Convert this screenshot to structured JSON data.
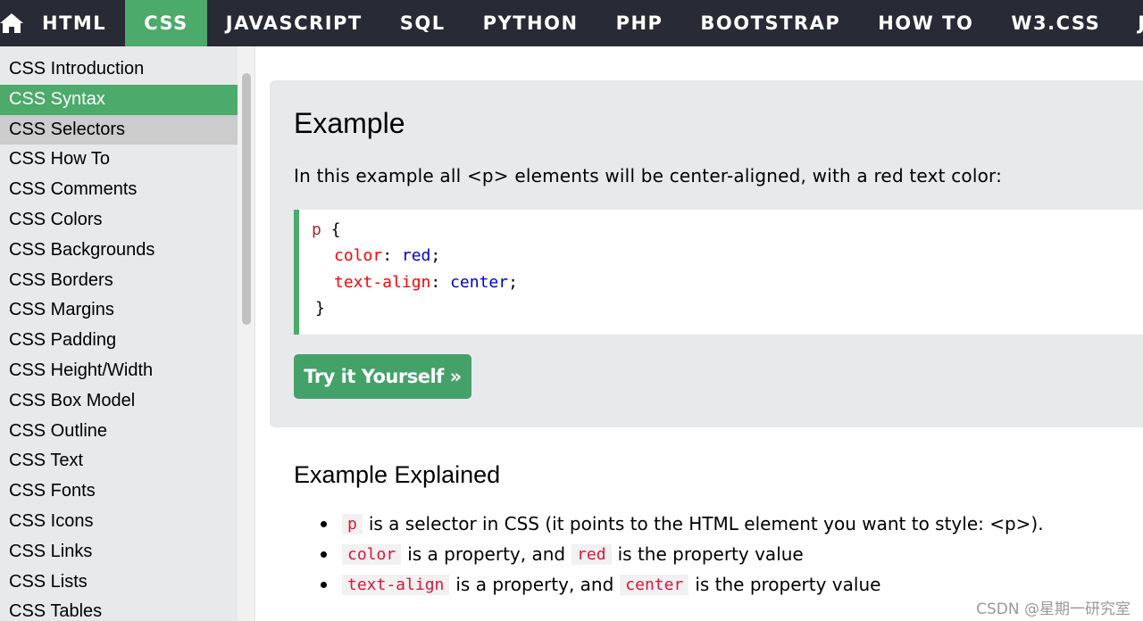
{
  "nav": {
    "home_icon": "home-icon",
    "items": [
      "HTML",
      "CSS",
      "JAVASCRIPT",
      "SQL",
      "PYTHON",
      "PHP",
      "BOOTSTRAP",
      "HOW TO",
      "W3.CSS",
      "JAVA",
      "J"
    ],
    "active": "CSS"
  },
  "sidebar": {
    "items": [
      "CSS Introduction",
      "CSS Syntax",
      "CSS Selectors",
      "CSS How To",
      "CSS Comments",
      "CSS Colors",
      "CSS Backgrounds",
      "CSS Borders",
      "CSS Margins",
      "CSS Padding",
      "CSS Height/Width",
      "CSS Box Model",
      "CSS Outline",
      "CSS Text",
      "CSS Fonts",
      "CSS Icons",
      "CSS Links",
      "CSS Lists",
      "CSS Tables"
    ],
    "active": "CSS Syntax",
    "hover": "CSS Selectors"
  },
  "example": {
    "title": "Example",
    "description": "In this example all <p> elements will be center-aligned, with a red text color:",
    "code": {
      "selector": "p",
      "open_brace": " {",
      "line1_prop": "color",
      "line1_val": "red",
      "line2_prop": "text-align",
      "line2_val": "center",
      "close_brace": "}"
    },
    "try_button": "Try it Yourself »"
  },
  "explained": {
    "title": "Example Explained",
    "bullets": [
      {
        "code": "p",
        "text": "is a selector in CSS (it points to the HTML element you want to style: <p>)."
      },
      {
        "code": "color",
        "text": "is a property, and",
        "code2": "red",
        "text2": "is the property value"
      },
      {
        "code": "text-align",
        "text": "is a property, and",
        "code2": "center",
        "text2": "is the property value"
      }
    ]
  },
  "watermark": "CSDN @星期一研究室",
  "colors": {
    "nav_bg": "#282a35",
    "accent_green": "#4caa6a",
    "example_bg": "#e7e9eb",
    "code_selector": "#a52a2a",
    "code_property": "#ff0000",
    "code_value": "#0000cd",
    "inline_code": "#dc143c"
  }
}
